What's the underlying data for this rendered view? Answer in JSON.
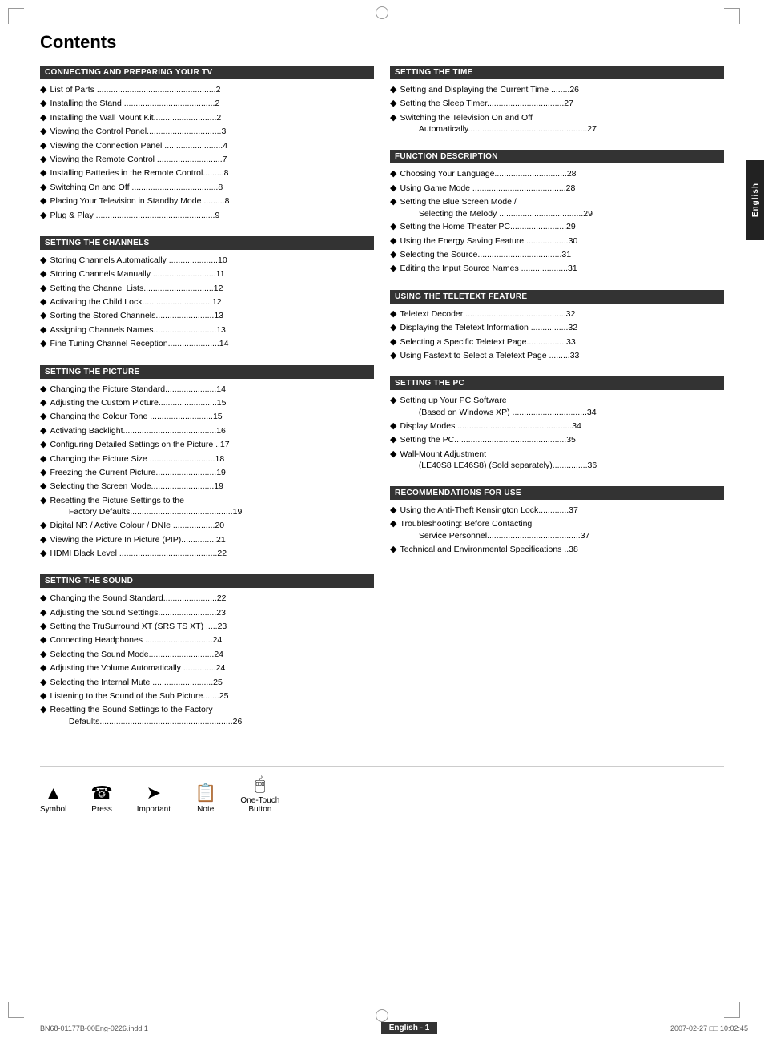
{
  "page": {
    "title": "Contents",
    "side_tab": "English",
    "footer_left": "BN68-01177B-00Eng-0226.indd   1",
    "footer_badge": "English - 1",
    "footer_right": "2007-02-27   □□ 10:02:45"
  },
  "legend": {
    "items": [
      {
        "id": "symbol",
        "icon": "▲",
        "label": "Symbol"
      },
      {
        "id": "press",
        "icon": "☎",
        "label": "Press"
      },
      {
        "id": "important",
        "icon": "➤",
        "label": "Important"
      },
      {
        "id": "note",
        "icon": "📋",
        "label": "Note"
      },
      {
        "id": "one-touch",
        "icon": "🖱",
        "label": "One-Touch\nButton"
      }
    ]
  },
  "left_sections": [
    {
      "id": "connecting",
      "header": "CONNECTING AND PREPARING YOUR TV",
      "items": [
        {
          "text": "List of Parts ...................................................2"
        },
        {
          "text": "Installing the Stand .......................................2"
        },
        {
          "text": "Installing the Wall Mount Kit...........................2"
        },
        {
          "text": "Viewing the Control Panel................................3"
        },
        {
          "text": "Viewing the Connection Panel .........................4"
        },
        {
          "text": "Viewing the Remote Control ............................7"
        },
        {
          "text": "Installing Batteries in the Remote Control.........8"
        },
        {
          "text": "Switching On and Off .....................................8"
        },
        {
          "text": "Placing Your Television in Standby Mode .........8"
        },
        {
          "text": "Plug & Play ...................................................9"
        }
      ]
    },
    {
      "id": "channels",
      "header": "SETTING THE CHANNELS",
      "items": [
        {
          "text": "Storing Channels Automatically .....................10"
        },
        {
          "text": "Storing Channels Manually ...........................11"
        },
        {
          "text": "Setting the Channel Lists..............................12"
        },
        {
          "text": "Activating the Child Lock..............................12"
        },
        {
          "text": "Sorting the Stored Channels.........................13"
        },
        {
          "text": "Assigning Channels Names...........................13"
        },
        {
          "text": "Fine Tuning Channel Reception......................14"
        }
      ]
    },
    {
      "id": "picture",
      "header": "SETTING THE PICTURE",
      "items": [
        {
          "text": "Changing the Picture Standard......................14"
        },
        {
          "text": "Adjusting the Custom Picture.........................15"
        },
        {
          "text": "Changing the Colour Tone ...........................15"
        },
        {
          "text": "Activating Backlight........................................16"
        },
        {
          "text": "Configuring Detailed Settings on the Picture ..17"
        },
        {
          "text": "Changing the Picture Size ............................18"
        },
        {
          "text": "Freezing the Current Picture..........................19"
        },
        {
          "text": "Selecting the Screen Mode...........................19"
        },
        {
          "text": "Resetting the Picture Settings to the\n        Factory Defaults............................................19"
        },
        {
          "text": "Digital NR / Active Colour / DNIe ..................20"
        },
        {
          "text": "Viewing the Picture In Picture (PIP)...............21"
        },
        {
          "text": "HDMI Black Level ..........................................22"
        }
      ]
    },
    {
      "id": "sound",
      "header": "SETTING THE SOUND",
      "items": [
        {
          "text": "Changing the Sound Standard.......................22"
        },
        {
          "text": "Adjusting the Sound Settings.........................23"
        },
        {
          "text": "Setting the TruSurround XT (SRS TS XT) .....23"
        },
        {
          "text": "Connecting Headphones .............................24"
        },
        {
          "text": "Selecting the Sound Mode............................24"
        },
        {
          "text": "Adjusting the Volume Automatically ..............24"
        },
        {
          "text": "Selecting the Internal Mute ..........................25"
        },
        {
          "text": "Listening to the Sound of the Sub Picture.......25"
        },
        {
          "text": "Resetting the Sound Settings to the Factory\n        Defaults.........................................................26"
        }
      ]
    }
  ],
  "right_sections": [
    {
      "id": "time",
      "header": "SETTING THE TIME",
      "items": [
        {
          "text": "Setting and Displaying the Current Time ........26"
        },
        {
          "text": "Setting the Sleep Timer.................................27"
        },
        {
          "text": "Switching the Television On and Off\n        Automatically...................................................27"
        }
      ]
    },
    {
      "id": "function",
      "header": "FUNCTION DESCRIPTION",
      "items": [
        {
          "text": "Choosing Your Language...............................28"
        },
        {
          "text": "Using Game Mode ........................................28"
        },
        {
          "text": "Setting the Blue Screen Mode /\n        Selecting the Melody ....................................29"
        },
        {
          "text": "Setting the Home Theater PC........................29"
        },
        {
          "text": "Using the Energy Saving Feature ..................30"
        },
        {
          "text": "Selecting the Source....................................31"
        },
        {
          "text": "Editing the Input Source Names ....................31"
        }
      ]
    },
    {
      "id": "teletext",
      "header": "USING THE TELETEXT FEATURE",
      "items": [
        {
          "text": "Teletext Decoder ...........................................32"
        },
        {
          "text": "Displaying the Teletext Information ................32"
        },
        {
          "text": "Selecting a Specific Teletext Page.................33"
        },
        {
          "text": "Using Fastext to Select a Teletext Page .........33"
        }
      ]
    },
    {
      "id": "pc",
      "header": "SETTING THE PC",
      "items": [
        {
          "text": "Setting up Your PC Software\n        (Based on Windows XP) ................................34"
        },
        {
          "text": "Display Modes .................................................34"
        },
        {
          "text": "Setting the PC................................................35"
        },
        {
          "text": "Wall-Mount Adjustment\n        (LE40S8 LE46S8) (Sold separately)...............36"
        }
      ]
    },
    {
      "id": "recommendations",
      "header": "RECOMMENDATIONS FOR USE",
      "items": [
        {
          "text": "Using the Anti-Theft Kensington Lock.............37"
        },
        {
          "text": "Troubleshooting: Before Contacting\n        Service Personnel........................................37"
        },
        {
          "text": "Technical and Environmental Specifications ..38"
        }
      ]
    }
  ]
}
